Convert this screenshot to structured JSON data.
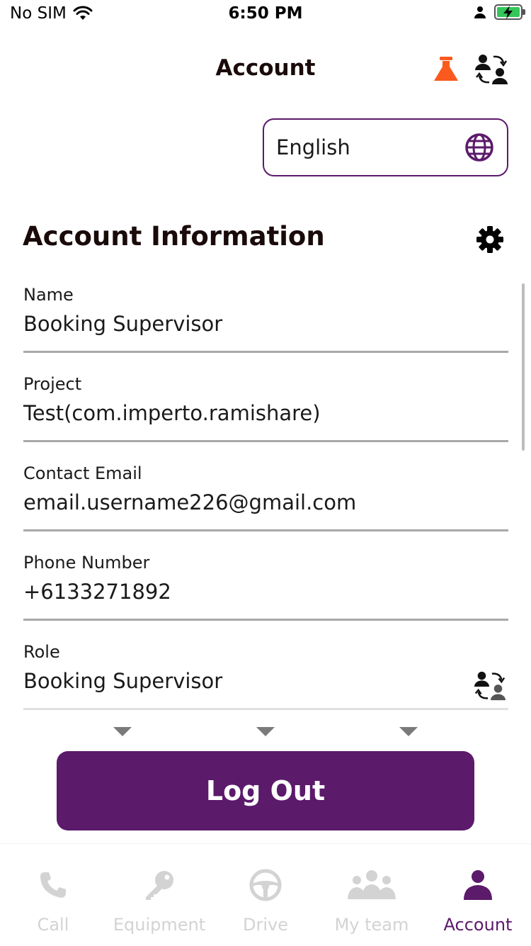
{
  "status_bar": {
    "carrier": "No SIM",
    "time": "6:50 PM"
  },
  "header": {
    "title": "Account",
    "flask_icon": "flask-icon",
    "switch_icon": "switch-users-icon",
    "flask_color": "#fa5a1e"
  },
  "language": {
    "value": "English",
    "icon": "globe-icon"
  },
  "account_info": {
    "title": "Account Information",
    "settings_icon": "gear-icon",
    "fields": [
      {
        "label": "Name",
        "value": "Booking Supervisor"
      },
      {
        "label": "Project",
        "value": "Test(com.imperto.ramishare)"
      },
      {
        "label": "Contact Email",
        "value": "email.username226@gmail.com"
      },
      {
        "label": "Phone Number",
        "value": "+6133271892"
      },
      {
        "label": "Role",
        "value": "Booking Supervisor"
      }
    ]
  },
  "logout_label": "Log Out",
  "tabs": [
    {
      "label": "Call",
      "icon": "phone-icon",
      "active": false
    },
    {
      "label": "Equipment",
      "icon": "key-icon",
      "active": false
    },
    {
      "label": "Drive",
      "icon": "steering-wheel-icon",
      "active": false
    },
    {
      "label": "My team",
      "icon": "team-icon",
      "active": false
    },
    {
      "label": "Account",
      "icon": "person-icon",
      "active": true
    }
  ],
  "colors": {
    "accent": "#5c1a6b",
    "flask": "#fa5a1e",
    "inactive_tab": "#d3d3d3",
    "divider": "#a8a8a8"
  }
}
